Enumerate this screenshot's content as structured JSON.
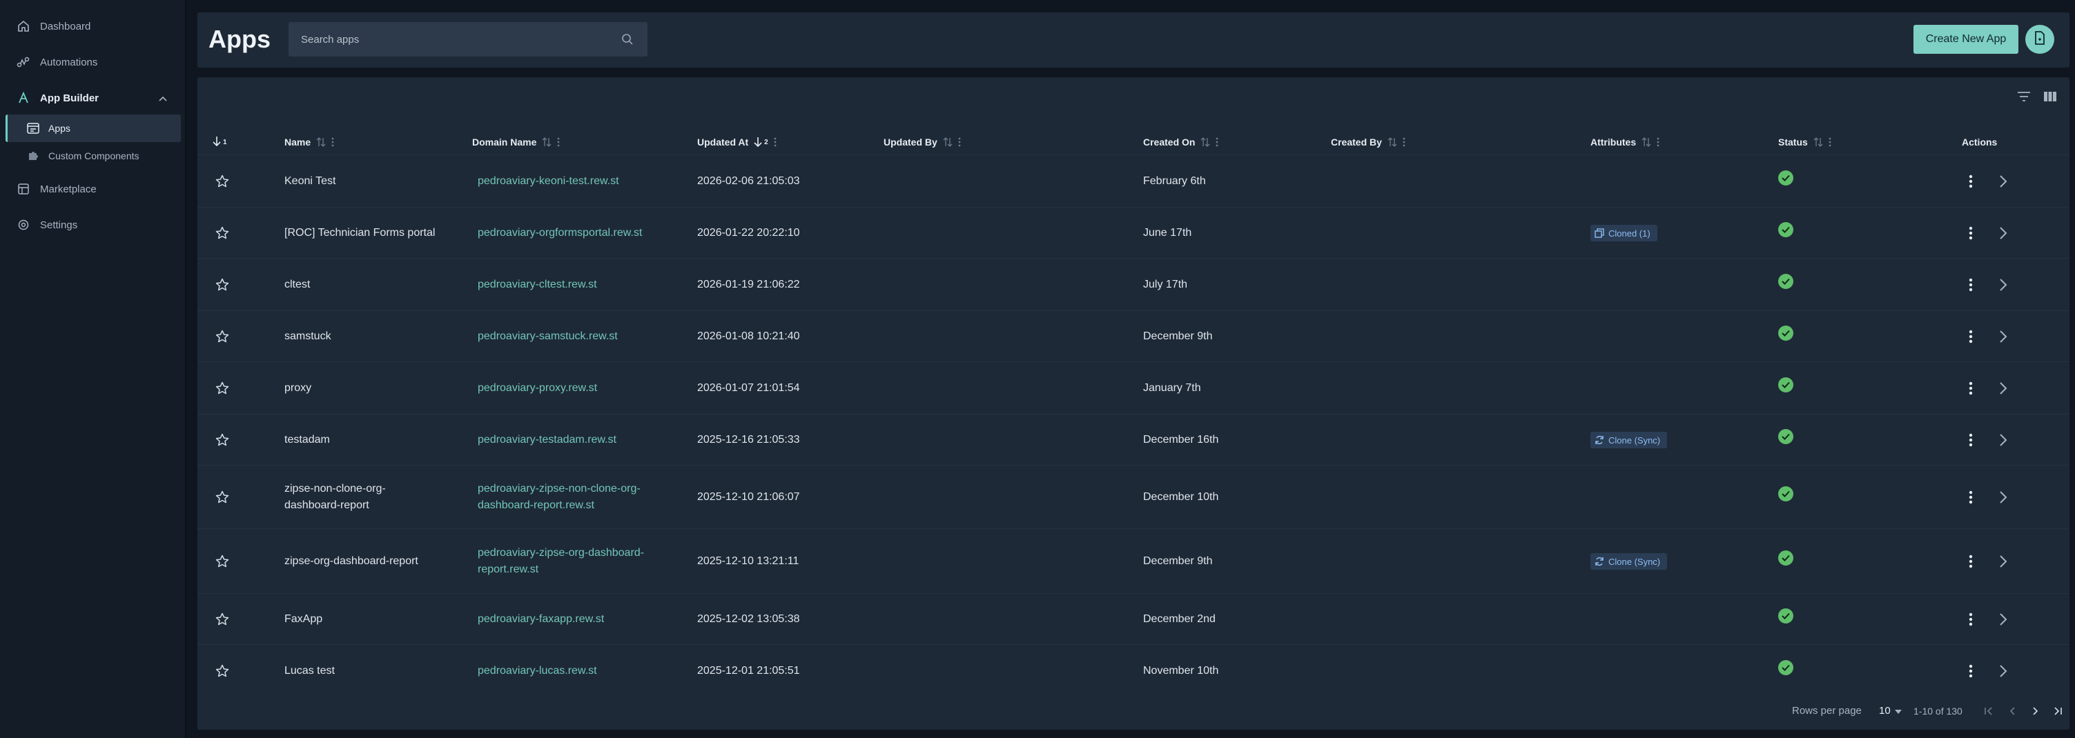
{
  "sidebar": {
    "items": [
      {
        "label": "Dashboard",
        "icon": "home-icon"
      },
      {
        "label": "Automations",
        "icon": "automation-icon"
      },
      {
        "label": "App Builder",
        "icon": "app-builder-icon"
      },
      {
        "label": "Apps",
        "icon": "apps-icon"
      },
      {
        "label": "Custom Components",
        "icon": "puzzle-icon"
      },
      {
        "label": "Marketplace",
        "icon": "marketplace-icon"
      },
      {
        "label": "Settings",
        "icon": "gear-icon"
      }
    ]
  },
  "header": {
    "title": "Apps",
    "search_placeholder": "Search apps",
    "create_label": "Create New App"
  },
  "table": {
    "sort_indicator": "1",
    "updated_sort_indicator": "2",
    "columns": [
      "Name",
      "Domain Name",
      "Updated At",
      "Updated By",
      "Created On",
      "Created By",
      "Attributes",
      "Status",
      "Actions"
    ],
    "rows": [
      {
        "name": [
          "Keoni Test"
        ],
        "domain": [
          "pedroaviary-keoni-test.rew.st"
        ],
        "updated_at": "2026-02-06 21:05:03",
        "created_on": "February 6th",
        "attribute": "",
        "status": "ok"
      },
      {
        "name": [
          "[ROC] Technician Forms portal"
        ],
        "domain": [
          "pedroaviary-orgformsportal.rew.st"
        ],
        "updated_at": "2026-01-22 20:22:10",
        "created_on": "June 17th",
        "attribute": "Cloned (1)",
        "attr_icon": "copy-icon",
        "status": "ok"
      },
      {
        "name": [
          "cltest"
        ],
        "domain": [
          "pedroaviary-cltest.rew.st"
        ],
        "updated_at": "2026-01-19 21:06:22",
        "created_on": "July 17th",
        "attribute": "",
        "status": "ok"
      },
      {
        "name": [
          "samstuck"
        ],
        "domain": [
          "pedroaviary-samstuck.rew.st"
        ],
        "updated_at": "2026-01-08 10:21:40",
        "created_on": "December 9th",
        "attribute": "",
        "status": "ok"
      },
      {
        "name": [
          "proxy"
        ],
        "domain": [
          "pedroaviary-proxy.rew.st"
        ],
        "updated_at": "2026-01-07 21:01:54",
        "created_on": "January 7th",
        "attribute": "",
        "status": "ok"
      },
      {
        "name": [
          "testadam"
        ],
        "domain": [
          "pedroaviary-testadam.rew.st"
        ],
        "updated_at": "2025-12-16 21:05:33",
        "created_on": "December 16th",
        "attribute": "Clone (Sync)",
        "attr_icon": "sync-icon",
        "status": "ok"
      },
      {
        "name": [
          "zipse-non-clone-org-",
          "dashboard-report"
        ],
        "domain": [
          "pedroaviary-zipse-non-clone-org-",
          "dashboard-report.rew.st"
        ],
        "updated_at": "2025-12-10 21:06:07",
        "created_on": "December 10th",
        "attribute": "",
        "status": "ok"
      },
      {
        "name": [
          "zipse-org-dashboard-report"
        ],
        "domain": [
          "pedroaviary-zipse-org-dashboard-",
          "report.rew.st"
        ],
        "updated_at": "2025-12-10 13:21:11",
        "created_on": "December 9th",
        "attribute": "Clone (Sync)",
        "attr_icon": "sync-icon",
        "status": "ok"
      },
      {
        "name": [
          "FaxApp"
        ],
        "domain": [
          "pedroaviary-faxapp.rew.st"
        ],
        "updated_at": "2025-12-02 13:05:38",
        "created_on": "December 2nd",
        "attribute": "",
        "status": "ok"
      },
      {
        "name": [
          "Lucas test"
        ],
        "domain": [
          "pedroaviary-lucas.rew.st"
        ],
        "updated_at": "2025-12-01 21:05:51",
        "created_on": "November 10th",
        "attribute": "",
        "status": "ok"
      }
    ]
  },
  "footer": {
    "rows_per_page_label": "Rows per page",
    "rows_per_page_value": "10",
    "range": "1-10 of 130"
  },
  "colors": {
    "accent": "#7ecfc4",
    "link": "#72c6b8",
    "status_ok": "#5fbf6a",
    "badge_text": "#8fbcf0"
  }
}
